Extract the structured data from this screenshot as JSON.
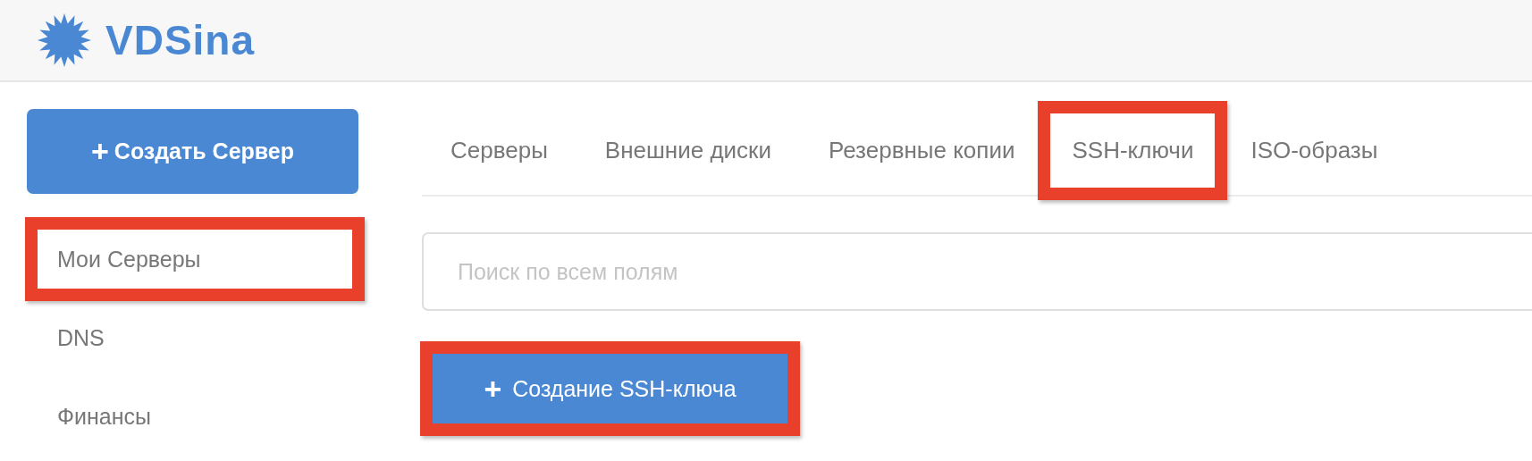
{
  "header": {
    "logo_text": "VDSina"
  },
  "sidebar": {
    "create_button": {
      "icon": "+",
      "label": "Создать Сервер"
    },
    "items": [
      {
        "label": "Мои Серверы",
        "highlighted": true
      },
      {
        "label": "DNS",
        "highlighted": false
      },
      {
        "label": "Финансы",
        "highlighted": false
      }
    ]
  },
  "tabs": [
    {
      "label": "Серверы",
      "highlighted": false
    },
    {
      "label": "Внешние диски",
      "highlighted": false
    },
    {
      "label": "Резервные копии",
      "highlighted": false
    },
    {
      "label": "SSH-ключи",
      "highlighted": true
    },
    {
      "label": "ISO-образы",
      "highlighted": false
    }
  ],
  "search": {
    "placeholder": "Поиск по всем полям"
  },
  "create_key_button": {
    "icon": "+",
    "label": "Создание SSH-ключа",
    "highlighted": true
  }
}
